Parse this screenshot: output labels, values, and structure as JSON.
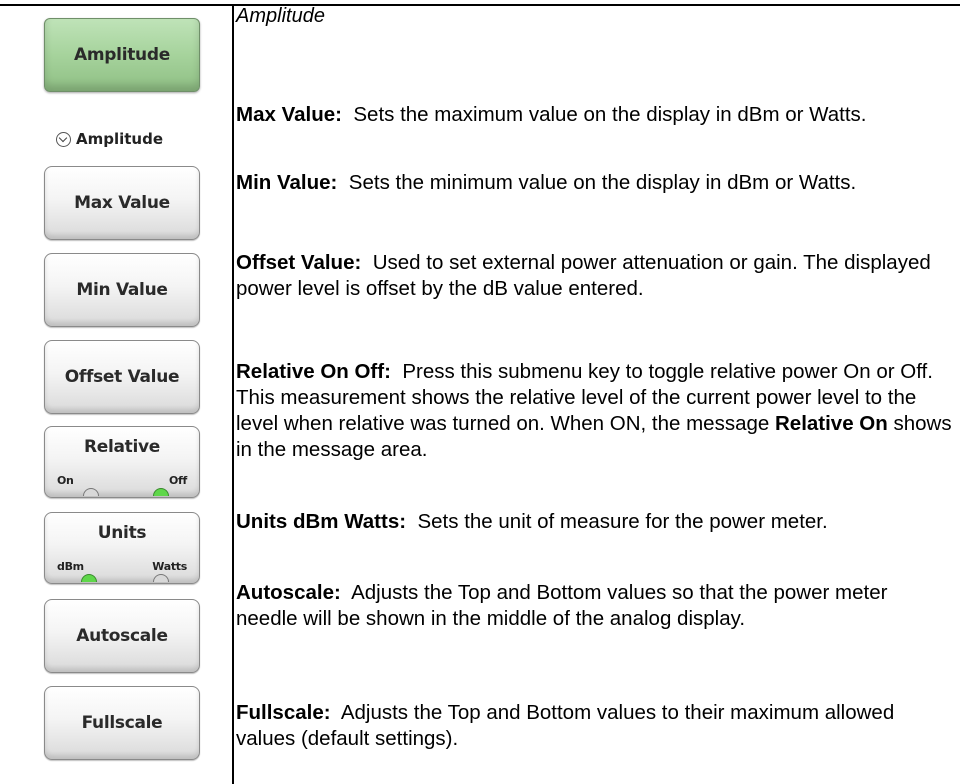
{
  "menu": {
    "main_key": "Amplitude",
    "submenu_title": "Amplitude",
    "keys": {
      "max_value": "Max Value",
      "min_value": "Min Value",
      "offset_value": "Offset Value",
      "relative": {
        "label": "Relative",
        "opt_on": "On",
        "opt_off": "Off",
        "selected": "Off"
      },
      "units": {
        "label": "Units",
        "opt_dbm": "dBm",
        "opt_watts": "Watts",
        "selected": "dBm"
      },
      "autoscale": "Autoscale",
      "fullscale": "Fullscale"
    }
  },
  "content": {
    "heading": "Amplitude",
    "entries": [
      {
        "term": "Max Value:",
        "text": "Sets the maximum value on the display in dBm or Watts."
      },
      {
        "term": "Min Value:",
        "text": "Sets the minimum value on the display in dBm or Watts."
      },
      {
        "term": "Offset Value:",
        "text": "Used to set external power attenuation or gain. The displayed power level is offset by the dB value entered."
      },
      {
        "term": "Relative On Off:",
        "text_before": "Press this submenu key to toggle relative power On or Off. This measurement shows the relative level of the current power level to the level when relative was turned on. When ON, the message",
        "bold_inline": "Relative On",
        "text_after": "shows in the message area."
      },
      {
        "term": "Units dBm Watts:",
        "text": "Sets the unit of measure for the power meter."
      },
      {
        "term": "Autoscale:",
        "text": "Adjusts the Top and Bottom values so that the power meter needle will be shown in the middle of the analog display."
      },
      {
        "term": "Fullscale:",
        "text": "Adjusts the Top and Bottom values to their maximum allowed values (default settings)."
      }
    ]
  }
}
